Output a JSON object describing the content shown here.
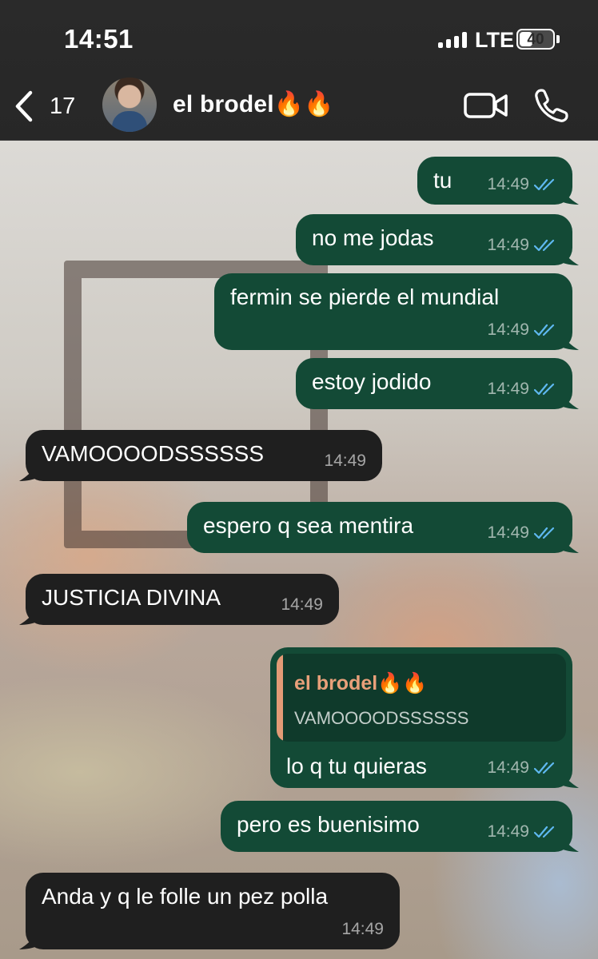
{
  "status_bar": {
    "time": "14:51",
    "network": "LTE",
    "battery": "40",
    "battery_level": 0.4
  },
  "header": {
    "back_count": "17",
    "contact_name": "el brodel🔥🔥",
    "icons": {
      "back": "chevron-left-icon",
      "video": "video-camera-icon",
      "call": "phone-icon"
    }
  },
  "messages": [
    {
      "dir": "out",
      "text": "tu",
      "time": "14:49",
      "read": true
    },
    {
      "dir": "out",
      "text": "no me jodas",
      "time": "14:49",
      "read": true
    },
    {
      "dir": "out",
      "text": "fermin se pierde el mundial",
      "time": "14:49",
      "read": true
    },
    {
      "dir": "out",
      "text": "estoy jodido",
      "time": "14:49",
      "read": true
    },
    {
      "dir": "in",
      "text": "VAMOOOODSSSSSS",
      "time": "14:49"
    },
    {
      "dir": "out",
      "text": "espero q sea mentira",
      "time": "14:49",
      "read": true
    },
    {
      "dir": "in",
      "text": "JUSTICIA DIVINA",
      "time": "14:49"
    },
    {
      "dir": "out",
      "quote_author": "el brodel🔥🔥",
      "quote_text": "VAMOOOODSSSSSS",
      "text": "lo q tu quieras",
      "time": "14:49",
      "read": true
    },
    {
      "dir": "out",
      "text": "pero es buenisimo",
      "time": "14:49",
      "read": true
    },
    {
      "dir": "in",
      "text": "Anda y q le folle un pez polla",
      "time": "14:49"
    }
  ],
  "colors": {
    "outgoing_bubble": "#134a36",
    "incoming_bubble": "#1f1f1f",
    "read_ticks": "#5eb8f0",
    "quote_accent": "#e39b76"
  }
}
